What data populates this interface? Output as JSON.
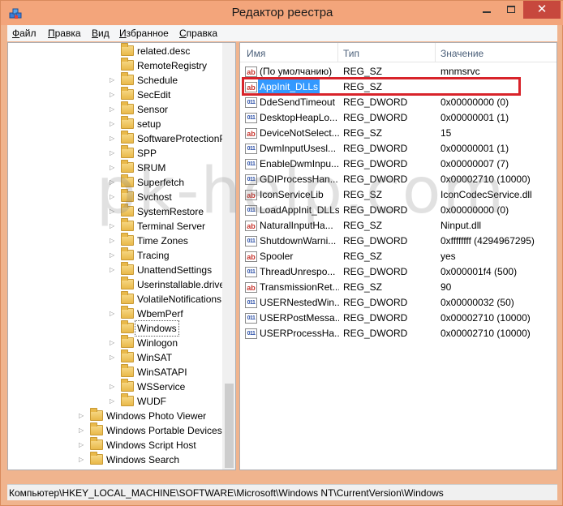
{
  "window": {
    "title": "Редактор реестра",
    "close_glyph": "✕",
    "accent_color": "#f3a57b",
    "selection_color": "#3399ff",
    "highlight_color": "#d8232a"
  },
  "menu": [
    "Файл",
    "Правка",
    "Вид",
    "Избранное",
    "Справка"
  ],
  "tree": {
    "items": [
      {
        "label": "related.desc",
        "has_children": false
      },
      {
        "label": "RemoteRegistry",
        "has_children": false
      },
      {
        "label": "Schedule",
        "has_children": true
      },
      {
        "label": "SecEdit",
        "has_children": true
      },
      {
        "label": "Sensor",
        "has_children": true
      },
      {
        "label": "setup",
        "has_children": true
      },
      {
        "label": "SoftwareProtectionPlatform",
        "has_children": true
      },
      {
        "label": "SPP",
        "has_children": true
      },
      {
        "label": "SRUM",
        "has_children": true
      },
      {
        "label": "Superfetch",
        "has_children": true
      },
      {
        "label": "Svchost",
        "has_children": true
      },
      {
        "label": "SystemRestore",
        "has_children": true
      },
      {
        "label": "Terminal Server",
        "has_children": true
      },
      {
        "label": "Time Zones",
        "has_children": true
      },
      {
        "label": "Tracing",
        "has_children": true
      },
      {
        "label": "UnattendSettings",
        "has_children": true
      },
      {
        "label": "Userinstallable.drivers",
        "has_children": false
      },
      {
        "label": "VolatileNotifications",
        "has_children": false
      },
      {
        "label": "WbemPerf",
        "has_children": true
      },
      {
        "label": "Windows",
        "has_children": false,
        "selected": true
      },
      {
        "label": "Winlogon",
        "has_children": true
      },
      {
        "label": "WinSAT",
        "has_children": true
      },
      {
        "label": "WinSATAPI",
        "has_children": false
      },
      {
        "label": "WSService",
        "has_children": true
      },
      {
        "label": "WUDF",
        "has_children": true
      }
    ],
    "root_items": [
      {
        "label": "Windows Photo Viewer",
        "has_children": true
      },
      {
        "label": "Windows Portable Devices",
        "has_children": true
      },
      {
        "label": "Windows Script Host",
        "has_children": true
      },
      {
        "label": "Windows Search",
        "has_children": true
      }
    ]
  },
  "list": {
    "headers": {
      "name": "Имя",
      "type": "Тип",
      "data": "Значение"
    },
    "rows": [
      {
        "icon": "string-value-icon",
        "kind": "sz",
        "name": "(По умолчанию)",
        "type": "REG_SZ",
        "data": "mnmsrvc"
      },
      {
        "icon": "string-value-icon",
        "kind": "sz",
        "name": "AppInit_DLLs",
        "type": "REG_SZ",
        "data": "",
        "selected": true
      },
      {
        "icon": "binary-value-icon",
        "kind": "dw",
        "name": "DdeSendTimeout",
        "type": "REG_DWORD",
        "data": "0x00000000 (0)"
      },
      {
        "icon": "binary-value-icon",
        "kind": "dw",
        "name": "DesktopHeapLo...",
        "type": "REG_DWORD",
        "data": "0x00000001 (1)"
      },
      {
        "icon": "string-value-icon",
        "kind": "sz",
        "name": "DeviceNotSelect...",
        "type": "REG_SZ",
        "data": "15"
      },
      {
        "icon": "binary-value-icon",
        "kind": "dw",
        "name": "DwmInputUsesl...",
        "type": "REG_DWORD",
        "data": "0x00000001 (1)"
      },
      {
        "icon": "binary-value-icon",
        "kind": "dw",
        "name": "EnableDwmInpu...",
        "type": "REG_DWORD",
        "data": "0x00000007 (7)"
      },
      {
        "icon": "binary-value-icon",
        "kind": "dw",
        "name": "GDIProcessHan...",
        "type": "REG_DWORD",
        "data": "0x00002710 (10000)"
      },
      {
        "icon": "string-value-icon",
        "kind": "sz",
        "name": "IconServiceLib",
        "type": "REG_SZ",
        "data": "IconCodecService.dll"
      },
      {
        "icon": "binary-value-icon",
        "kind": "dw",
        "name": "LoadAppInit_DLLs",
        "type": "REG_DWORD",
        "data": "0x00000000 (0)"
      },
      {
        "icon": "string-value-icon",
        "kind": "sz",
        "name": "NaturalInputHa...",
        "type": "REG_SZ",
        "data": "Ninput.dll"
      },
      {
        "icon": "binary-value-icon",
        "kind": "dw",
        "name": "ShutdownWarni...",
        "type": "REG_DWORD",
        "data": "0xffffffff (4294967295)"
      },
      {
        "icon": "string-value-icon",
        "kind": "sz",
        "name": "Spooler",
        "type": "REG_SZ",
        "data": "yes"
      },
      {
        "icon": "binary-value-icon",
        "kind": "dw",
        "name": "ThreadUnrespo...",
        "type": "REG_DWORD",
        "data": "0x000001f4 (500)"
      },
      {
        "icon": "string-value-icon",
        "kind": "sz",
        "name": "TransmissionRet...",
        "type": "REG_SZ",
        "data": "90"
      },
      {
        "icon": "binary-value-icon",
        "kind": "dw",
        "name": "USERNestedWin...",
        "type": "REG_DWORD",
        "data": "0x00000032 (50)"
      },
      {
        "icon": "binary-value-icon",
        "kind": "dw",
        "name": "USERPostMessa...",
        "type": "REG_DWORD",
        "data": "0x00002710 (10000)"
      },
      {
        "icon": "binary-value-icon",
        "kind": "dw",
        "name": "USERProcessHa...",
        "type": "REG_DWORD",
        "data": "0x00002710 (10000)"
      }
    ]
  },
  "status": "Компьютер\\HKEY_LOCAL_MACHINE\\SOFTWARE\\Microsoft\\Windows NT\\CurrentVersion\\Windows",
  "watermark": "pk-help.com"
}
